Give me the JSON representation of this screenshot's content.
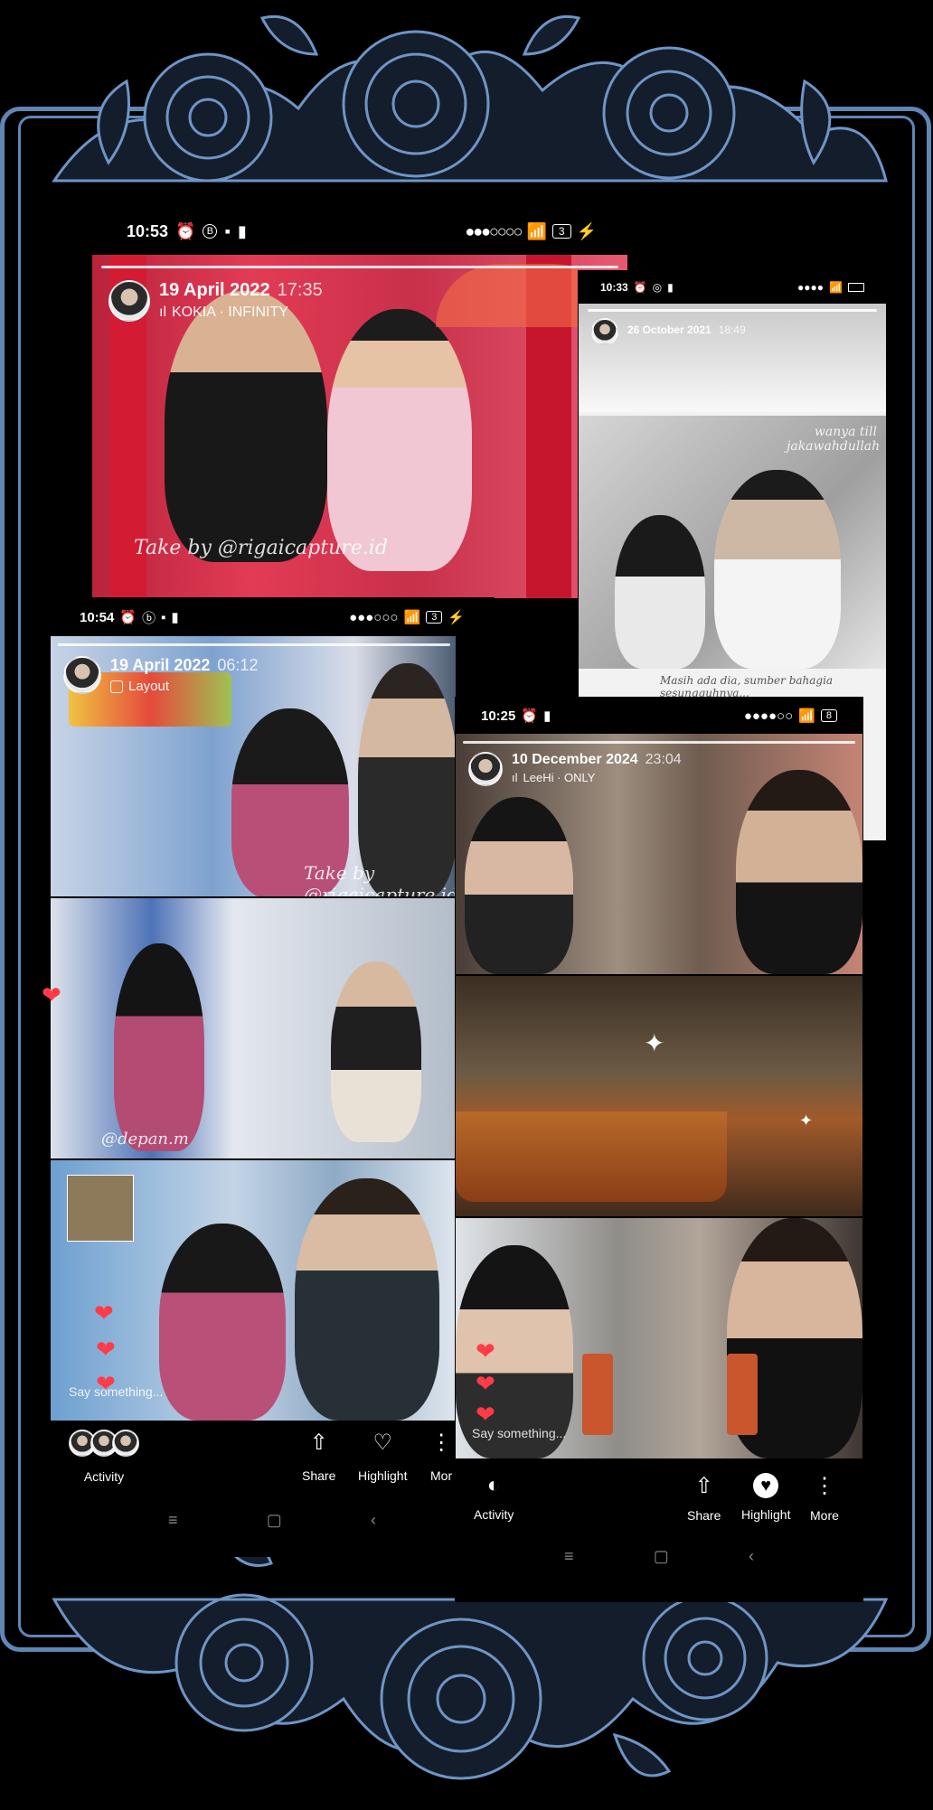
{
  "colors": {
    "frame": "#5f86b5",
    "floral_fill": "#141d2b",
    "floral_line": "#6e95c6",
    "heart": "#ff3b47"
  },
  "story1": {
    "status_time": "10:53",
    "date": "19 April 2022",
    "time": "17:35",
    "music_icon": "music-bars-icon",
    "sub": "KOKIA · INFINITY",
    "watermark": "Take by @rigaicapture.id"
  },
  "story2": {
    "status_time": "10:33",
    "date": "26 October 2021",
    "time": "18:49",
    "handwriting": "wanya till jakawahdullah",
    "caption": "Masih ada dia, sumber bahagia sesungguhnya..."
  },
  "story3": {
    "status_time": "10:54",
    "date": "19 April 2022",
    "time": "06:12",
    "layout_icon": "layout-grid-icon",
    "sub": "Layout",
    "watermark1": "Take by @rigaicapture.id",
    "watermark2": "@depan.m",
    "say": "Say something...",
    "bottom": {
      "activity": "Activity",
      "share": "Share",
      "highlight": "Highlight",
      "more": "Mor"
    }
  },
  "story4": {
    "status_time": "10:25",
    "battery": "8",
    "date": "10 December 2024",
    "time": "23:04",
    "sub": "LeeHi · ONLY",
    "say": "Say something...",
    "bottom": {
      "activity": "Activity",
      "share": "Share",
      "highlight": "Highlight",
      "more": "More"
    }
  },
  "status_icons": {
    "battery1": "3",
    "battery3": "3"
  }
}
